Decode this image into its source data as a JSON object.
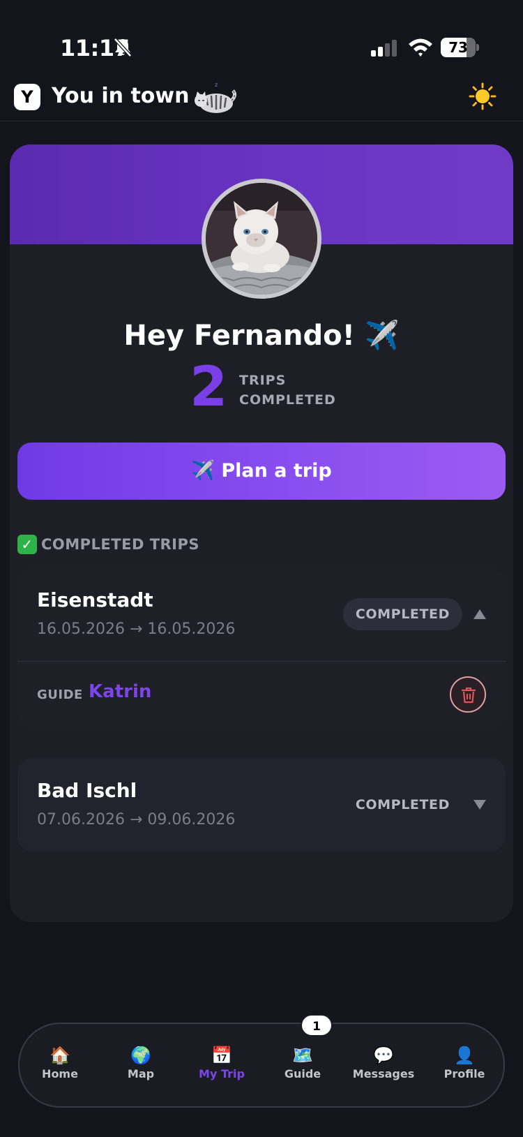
{
  "status_bar": {
    "time": "11:17",
    "battery": "73",
    "battery_level": 0.73
  },
  "header": {
    "logo_letter": "Y",
    "title": "You in town"
  },
  "profile": {
    "greeting": "Hey Fernando! ✈️",
    "trip_count": "2",
    "trips_label_line1": "TRIPS",
    "trips_label_line2": "COMPLETED"
  },
  "plan_button_label": "✈️ Plan a trip",
  "completed_section": {
    "icon": "✓",
    "title": "COMPLETED TRIPS"
  },
  "trips": [
    {
      "name": "Eisenstadt",
      "dates": "16.05.2026 → 16.05.2026",
      "status": "COMPLETED",
      "expanded": true,
      "guide_label": "GUIDE",
      "guide_name": "Katrin"
    },
    {
      "name": "Bad Ischl",
      "dates": "07.06.2026 → 09.06.2026",
      "status": "COMPLETED",
      "expanded": false
    }
  ],
  "nav": {
    "items": [
      {
        "label": "Home",
        "icon": "🏠"
      },
      {
        "label": "Map",
        "icon": "🌍"
      },
      {
        "label": "My Trip",
        "icon": "📅"
      },
      {
        "label": "Guide",
        "icon": "🗺️"
      },
      {
        "label": "Messages",
        "icon": "💬"
      },
      {
        "label": "Profile",
        "icon": "👤"
      }
    ],
    "active": "My Trip",
    "guide_badge": "1"
  },
  "colors": {
    "background": "#14141c",
    "accent": "#7b45ea",
    "banner": "#6a35c4"
  }
}
